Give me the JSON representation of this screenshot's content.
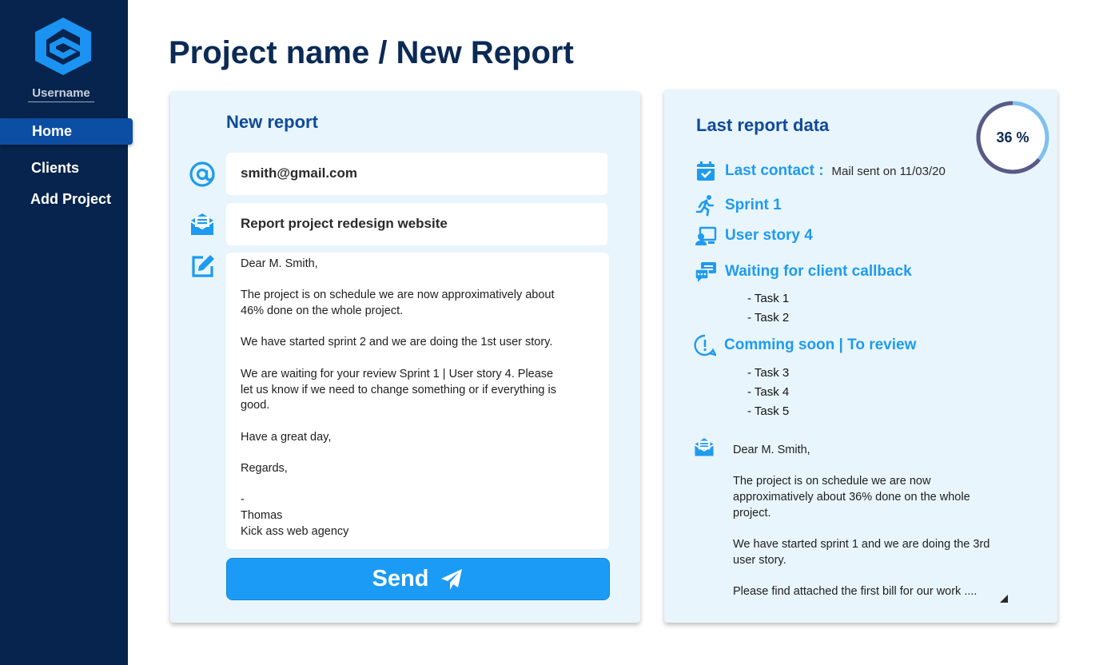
{
  "sidebar": {
    "username": "Username",
    "nav": [
      "Home",
      "Clients",
      "Add Project"
    ],
    "active": "Home"
  },
  "page_title": "Project name / New Report",
  "new_report": {
    "heading": "New report",
    "email": "smith@gmail.com",
    "subject": "Report project redesign website",
    "body_lines": [
      "Dear M. Smith,",
      "",
      "The project is on schedule we are now approximatively about",
      "46% done on the whole project.",
      "",
      "We have started sprint 2 and we are doing the 1st user story.",
      "",
      "We are waiting for your review Sprint 1 | User story 4.  Please",
      "let us know if we need to change something or if everything is",
      "good.",
      "",
      "Have a great day,",
      "",
      "Regards,",
      "",
      "-",
      "Thomas",
      "Kick ass web agency"
    ],
    "send_label": "Send",
    "icons": [
      "at-icon",
      "mail-open-icon",
      "edit-icon",
      "paper-plane-icon"
    ]
  },
  "last_report": {
    "heading": "Last report data",
    "progress_label": "36 %",
    "progress_value": 0.36,
    "last_contact_label": "Last contact :",
    "last_contact_value": "Mail sent on 11/03/20",
    "sprint": "Sprint 1",
    "user_story": "User story 4",
    "waiting": "Waiting for client callback",
    "waiting_tasks": [
      "- Task 1",
      "- Task 2"
    ],
    "coming": "Comming soon | To review",
    "coming_tasks": [
      "- Task 3",
      "- Task 4",
      "- Task 5"
    ],
    "preview_lines": [
      "Dear M. Smith,",
      "",
      "The project is on schedule we are now",
      "approximatively about 36% done on the whole",
      "project.",
      "",
      "We have started sprint 1 and we are doing the 3rd",
      "user story.",
      "",
      "Please find attached the first bill for our work ...."
    ],
    "icons": [
      "calendar-check-icon",
      "running-icon",
      "user-screen-icon",
      "chat-icon",
      "alert-circle-icon",
      "mail-open-icon"
    ]
  },
  "colors": {
    "sidebar_bg": "#06244d",
    "nav_active": "#0c4ea3",
    "accent": "#1e9bf0",
    "heading": "#0e4a9b",
    "card_bg": "#e9f5fd",
    "progress_track": "#7ec0ef",
    "progress_fill": "#5a5a86"
  }
}
